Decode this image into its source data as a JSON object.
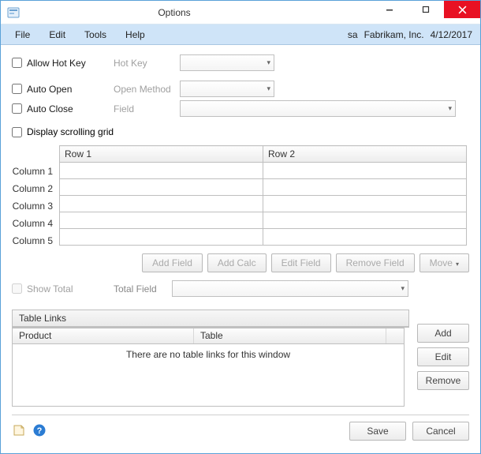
{
  "titlebar": {
    "title": "Options"
  },
  "menubar": {
    "items": [
      "File",
      "Edit",
      "Tools",
      "Help"
    ],
    "user": "sa",
    "company": "Fabrikam, Inc.",
    "date": "4/12/2017"
  },
  "options": {
    "allow_hot_key": {
      "label": "Allow Hot Key",
      "field_label": "Hot Key"
    },
    "auto_open": {
      "label": "Auto Open",
      "field_label": "Open Method"
    },
    "auto_close": {
      "label": "Auto Close",
      "field_label": "Field"
    },
    "display_scrolling_grid": {
      "label": "Display scrolling grid"
    }
  },
  "grid": {
    "columns": [
      "Row 1",
      "Row 2"
    ],
    "rows": [
      "Column 1",
      "Column 2",
      "Column 3",
      "Column 4",
      "Column 5"
    ]
  },
  "grid_buttons": {
    "add_field": "Add Field",
    "add_calc": "Add Calc",
    "edit_field": "Edit Field",
    "remove_field": "Remove Field",
    "move": "Move"
  },
  "show_total": {
    "label": "Show Total",
    "field_label": "Total Field"
  },
  "table_links": {
    "header": "Table Links",
    "col_product": "Product",
    "col_table": "Table",
    "empty_text": "There are no table links for this window",
    "add": "Add",
    "edit": "Edit",
    "remove": "Remove"
  },
  "footer": {
    "save": "Save",
    "cancel": "Cancel"
  }
}
